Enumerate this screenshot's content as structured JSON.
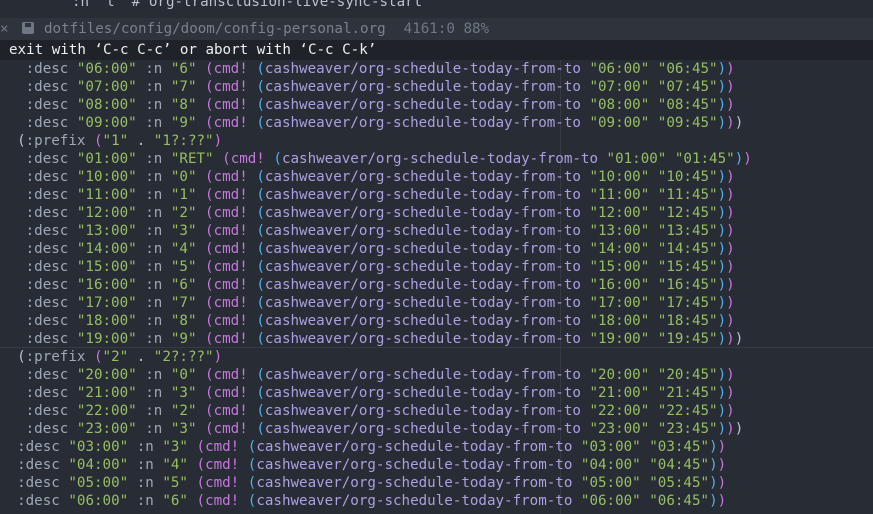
{
  "top_line": ":n \"l\" #'org-transclusion-live-sync-start",
  "modeline": {
    "close_glyph": "×",
    "file_path": "dotfiles/config/doom/config-personal.org",
    "position": "4161:0 88%"
  },
  "message": "exit with ‘C-c C-c’ or abort with ‘C-c C-k’",
  "lines": [
    {
      "indent": "   ",
      "desc": "06:00",
      "key": "6",
      "from": "06:00",
      "to": "06:45",
      "close": "))"
    },
    {
      "indent": "   ",
      "desc": "07:00",
      "key": "7",
      "from": "07:00",
      "to": "07:45",
      "close": "))"
    },
    {
      "indent": "   ",
      "desc": "08:00",
      "key": "8",
      "from": "08:00",
      "to": "08:45",
      "close": "))"
    },
    {
      "indent": "   ",
      "desc": "09:00",
      "key": "9",
      "from": "09:00",
      "to": "09:45",
      "close": ")))"
    },
    {
      "prefix": true,
      "indent": "  ",
      "key": "1",
      "label": "1?:??"
    },
    {
      "indent": "   ",
      "desc": "01:00",
      "key": "RET",
      "from": "01:00",
      "to": "01:45",
      "close": "))"
    },
    {
      "indent": "   ",
      "desc": "10:00",
      "key": "0",
      "from": "10:00",
      "to": "10:45",
      "close": "))"
    },
    {
      "indent": "   ",
      "desc": "11:00",
      "key": "1",
      "from": "11:00",
      "to": "11:45",
      "close": "))"
    },
    {
      "indent": "   ",
      "desc": "12:00",
      "key": "2",
      "from": "12:00",
      "to": "12:45",
      "close": "))"
    },
    {
      "indent": "   ",
      "desc": "13:00",
      "key": "3",
      "from": "13:00",
      "to": "13:45",
      "close": "))"
    },
    {
      "indent": "   ",
      "desc": "14:00",
      "key": "4",
      "from": "14:00",
      "to": "14:45",
      "close": "))"
    },
    {
      "indent": "   ",
      "desc": "15:00",
      "key": "5",
      "from": "15:00",
      "to": "15:45",
      "close": "))"
    },
    {
      "indent": "   ",
      "desc": "16:00",
      "key": "6",
      "from": "16:00",
      "to": "16:45",
      "close": "))"
    },
    {
      "indent": "   ",
      "desc": "17:00",
      "key": "7",
      "from": "17:00",
      "to": "17:45",
      "close": "))"
    },
    {
      "indent": "   ",
      "desc": "18:00",
      "key": "8",
      "from": "18:00",
      "to": "18:45",
      "close": "))"
    },
    {
      "indent": "   ",
      "desc": "19:00",
      "key": "9",
      "from": "19:00",
      "to": "19:45",
      "close": ")))"
    },
    {
      "prefix": true,
      "indent": "  ",
      "key": "2",
      "label": "2?:??"
    },
    {
      "indent": "   ",
      "desc": "20:00",
      "key": "0",
      "from": "20:00",
      "to": "20:45",
      "close": "))"
    },
    {
      "indent": "   ",
      "desc": "21:00",
      "key": "3",
      "from": "21:00",
      "to": "21:45",
      "close": "))"
    },
    {
      "indent": "   ",
      "desc": "22:00",
      "key": "2",
      "from": "22:00",
      "to": "22:45",
      "close": "))"
    },
    {
      "indent": "   ",
      "desc": "23:00",
      "key": "3",
      "from": "23:00",
      "to": "23:45",
      "close": ")))"
    },
    {
      "indent": "  ",
      "desc": "03:00",
      "key": "3",
      "from": "03:00",
      "to": "03:45",
      "close": "))"
    },
    {
      "indent": "  ",
      "desc": "04:00",
      "key": "4",
      "from": "04:00",
      "to": "04:45",
      "close": "))"
    },
    {
      "indent": "  ",
      "desc": "05:00",
      "key": "5",
      "from": "05:00",
      "to": "05:45",
      "close": "))"
    },
    {
      "indent": "  ",
      "desc": "06:00",
      "key": "6",
      "from": "06:00",
      "to": "06:45",
      "close": "))"
    }
  ],
  "syntax": {
    "desc_kw": ":desc",
    "n_kw": ":n",
    "prefix_kw": ":prefix",
    "cmd": "cmd!",
    "fn": "cashweaver/org-schedule-today-from-to"
  }
}
